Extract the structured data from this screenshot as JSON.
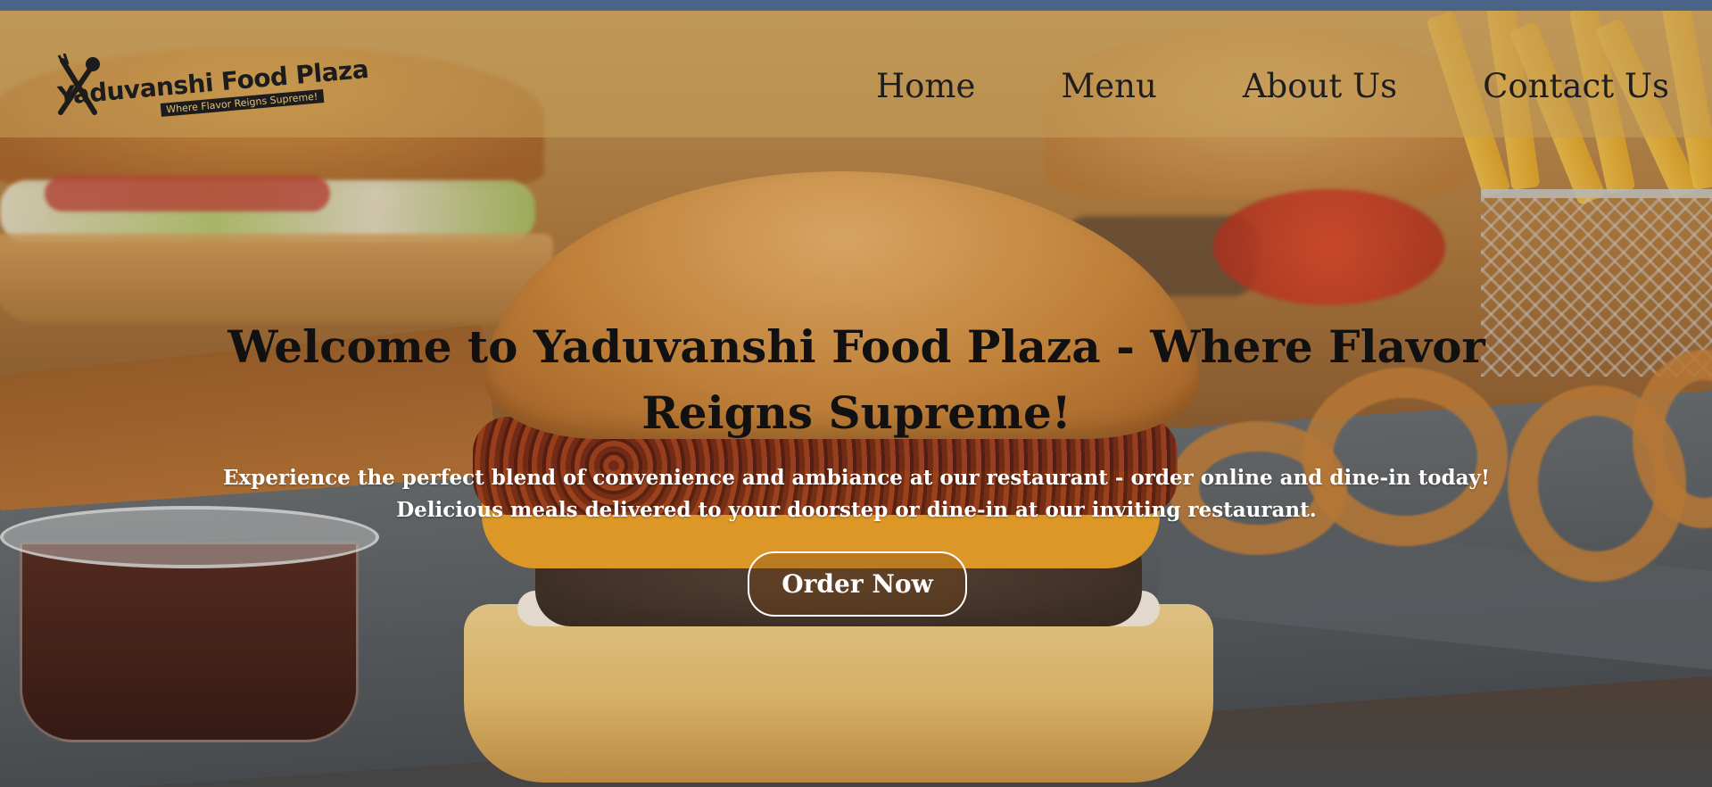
{
  "brand": {
    "name": "Yaduvanshi Food Plaza",
    "tagline": "Where Flavor Reigns Supreme!",
    "logo_icon": "fork-knife-icon"
  },
  "nav": {
    "items": [
      {
        "label": "Home"
      },
      {
        "label": "Menu"
      },
      {
        "label": "About Us"
      },
      {
        "label": "Contact Us"
      }
    ]
  },
  "hero": {
    "title": "Welcome to Yaduvanshi Food Plaza - Where Flavor Reigns Supreme!",
    "subtitle_line1": "Experience the perfect blend of convenience and ambiance at our restaurant - order online and dine-in today!",
    "subtitle_line2": "Delicious meals delivered to your doorstep or dine-in at our inviting restaurant.",
    "cta_label": "Order Now",
    "background": "burger-fries-onion-rings-photo"
  },
  "colors": {
    "top_strip": "#4a6488",
    "header_overlay": "#c8a05a",
    "title_text": "#111111",
    "subtitle_text": "#ffffff"
  }
}
